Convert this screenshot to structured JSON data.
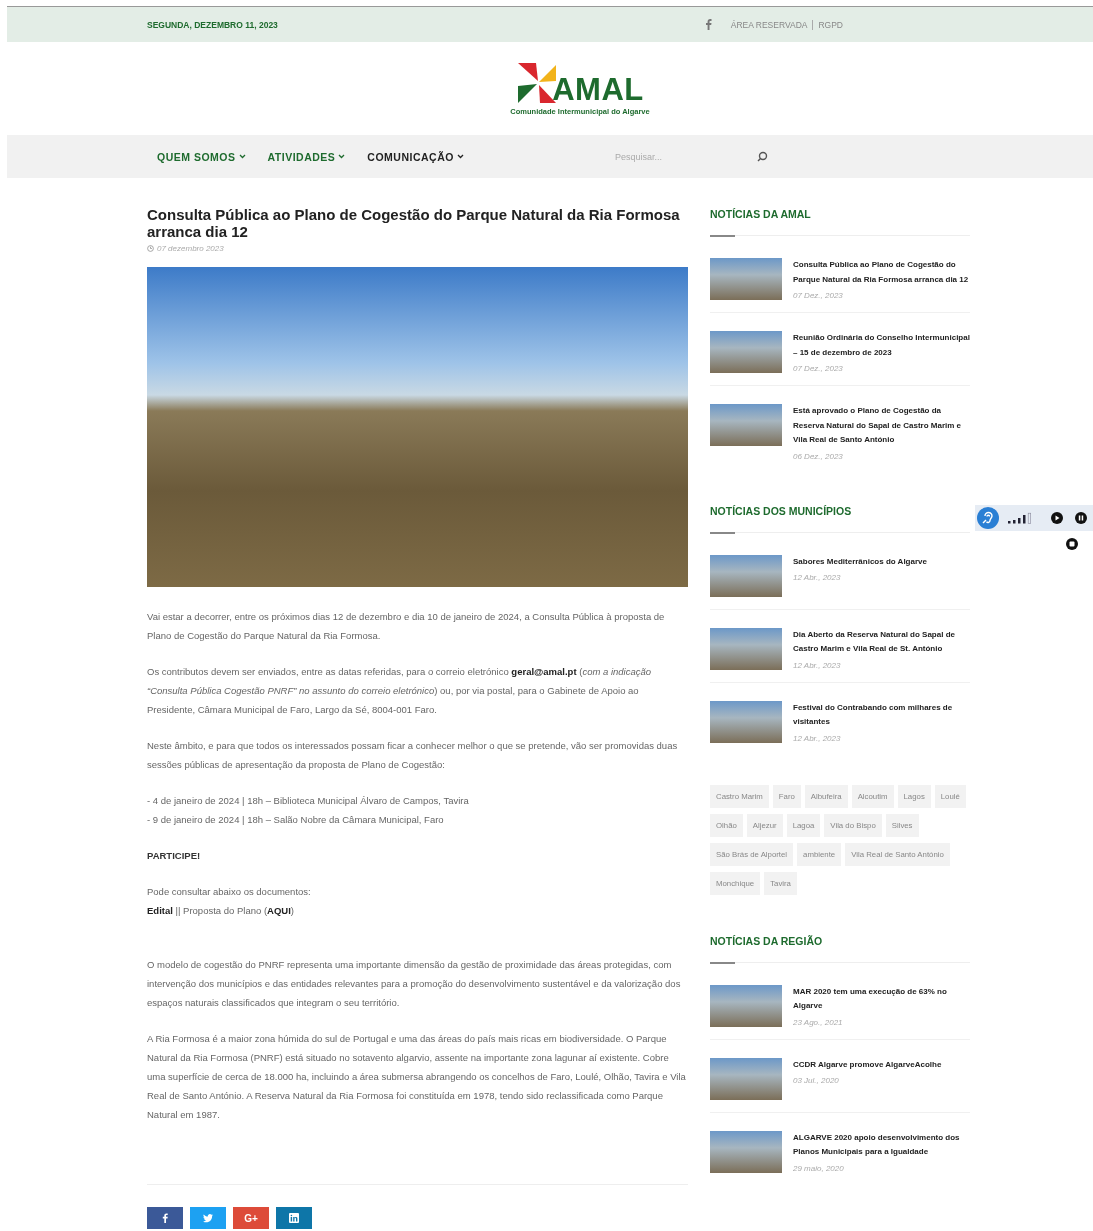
{
  "top_bar": {
    "date": "SEGUNDA, DEZEMBRO 11, 2023",
    "links": [
      "ÁREA RESERVADA",
      "RGPD"
    ]
  },
  "logo": {
    "name": "AMAL",
    "tagline": "Comunidade Intermunicipal do Algarve"
  },
  "nav": {
    "items": [
      {
        "label": "QUEM SOMOS",
        "color": "#1e6b2e"
      },
      {
        "label": "ATIVIDADES",
        "color": "#1e6b2e"
      },
      {
        "label": "COMUNICAÇÃO",
        "color": "#222222"
      }
    ],
    "search": {
      "placeholder": "Pesquisar..."
    }
  },
  "article": {
    "title": "Consulta Pública ao Plano de Cogestão do Parque Natural da Ria Formosa arranca dia 12",
    "date": "07 dezembro 2023",
    "blocks": [
      {
        "kind": "paragraph",
        "text": "Vai estar a decorrer, entre os próximos dias 12 de dezembro e dia 10 de janeiro de 2024, a Consulta Pública à proposta de Plano de Cogestão do Parque Natural da Ria Formosa."
      },
      {
        "kind": "paragraph",
        "text": "Os contributos devem ser enviados, entre as datas referidas, para o correio eletrónico **geral@amal.pt** (*com a indicação “Consulta Pública Cogestão PNRF” no assunto do correio eletrónico*) ou, por via postal, para o Gabinete de Apoio ao Presidente, Câmara Municipal de Faro, Largo da Sé, 8004-001 Faro."
      },
      {
        "kind": "paragraph",
        "text": "Neste âmbito, e para que todos os interessados possam ficar a conhecer melhor o que se pretende, vão ser promovidas duas sessões públicas de apresentação da proposta de Plano de Cogestão:"
      },
      {
        "kind": "lines",
        "lines": [
          "- 4 de janeiro de 2024 | 18h – Biblioteca Municipal Álvaro de Campos, Tavira",
          "- 9 de janeiro de 2024 | 18h – Salão Nobre da Câmara Municipal, Faro"
        ]
      },
      {
        "kind": "strong",
        "text": "PARTICIPE!"
      },
      {
        "kind": "lines",
        "lines": [
          "Pode consultar abaixo os documentos:",
          "**Edital** ||  Proposta do Plano (**AQUI**)"
        ]
      },
      {
        "kind": "spacer"
      },
      {
        "kind": "paragraph",
        "text": "O modelo de cogestão do PNRF representa uma importante dimensão da gestão de proximidade das áreas protegidas, com intervenção dos municípios e das entidades relevantes para a promoção do desenvolvimento sustentável e da valorização dos espaços naturais classificados que integram o seu território."
      },
      {
        "kind": "paragraph",
        "text": "A Ria Formosa é a maior zona húmida do sul de Portugal e uma das áreas do país mais ricas em biodiversidade. O Parque Natural da Ria Formosa (PNRF) está situado no sotavento algarvio, assente na importante zona lagunar aí existente. Cobre uma superfície de cerca de 18.000 ha, incluindo a área submersa abrangendo os concelhos de Faro, Loulé, Olhão, Tavira e Vila Real de Santo António. A Reserva Natural da Ria Formosa foi constituída em 1978, tendo sido reclassificada como Parque Natural em 1987."
      }
    ],
    "share_buttons": [
      {
        "kind": "facebook"
      },
      {
        "kind": "twitter"
      },
      {
        "kind": "google-plus",
        "label": "G+"
      },
      {
        "kind": "linkedin"
      }
    ]
  },
  "sidebar": [
    {
      "kind": "news",
      "title": "NOTÍCIAS DA AMAL",
      "items": [
        {
          "title": "Consulta Pública ao Plano de Cogestão do Parque Natural da Ria Formosa arranca dia 12",
          "date": "07 Dez., 2023"
        },
        {
          "title": "Reunião Ordinária do Conselho Intermunicipal – 15 de dezembro de 2023",
          "date": "07 Dez., 2023"
        },
        {
          "title": "Está aprovado o Plano de Cogestão da Reserva Natural do Sapal de Castro Marim e Vila Real de Santo António",
          "date": "06 Dez., 2023"
        }
      ]
    },
    {
      "kind": "news",
      "title": "NOTÍCIAS DOS MUNICÍPIOS",
      "items": [
        {
          "title": "Sabores Mediterrânicos do Algarve",
          "date": "12 Abr., 2023"
        },
        {
          "title": "Dia Aberto da Reserva Natural do Sapal de Castro Marim e Vila Real de St. António",
          "date": "12 Abr., 2023"
        },
        {
          "title": "Festival do Contrabando com milhares de visitantes",
          "date": "12 Abr., 2023"
        }
      ]
    },
    {
      "kind": "tags",
      "tags": [
        "Castro Marim",
        "Faro",
        "Albufeira",
        "Alcoutim",
        "Lagos",
        "Loulé",
        "Olhão",
        "Aljezur",
        "Lagoa",
        "Vila do Bispo",
        "Silves",
        "São Brás de Alportel",
        "ambiente",
        "Vila Real de Santo António",
        "Monchique",
        "Tavira"
      ]
    },
    {
      "kind": "news",
      "title": "NOTÍCIAS DA REGIÃO",
      "items": [
        {
          "title": "MAR 2020 tem uma execução de 63% no Algarve",
          "date": "23 Ago., 2021"
        },
        {
          "title": "CCDR Algarve promove AlgarveAcolhe",
          "date": "03 Jul., 2020"
        },
        {
          "title": "ALGARVE 2020 apoio desenvolvimento dos Planos Municipais para a Igualdade",
          "date": "29 maio, 2020"
        }
      ]
    }
  ]
}
